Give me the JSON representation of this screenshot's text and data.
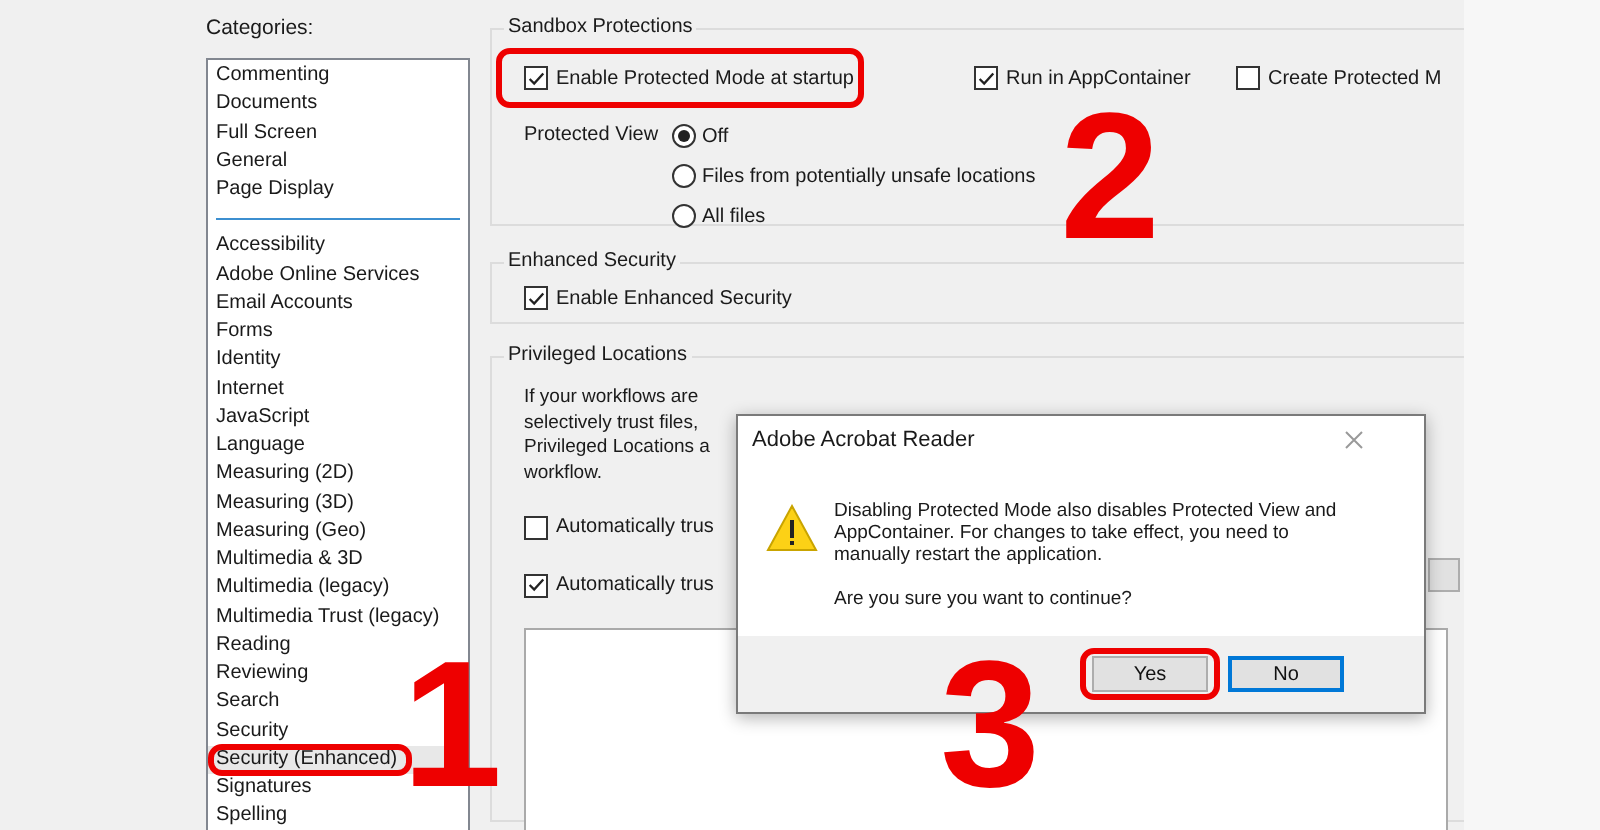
{
  "categories": {
    "label": "Categories:",
    "groups": [
      {
        "items": [
          {
            "label": "Commenting",
            "selected": false,
            "outlined": false
          },
          {
            "label": "Documents",
            "selected": false,
            "outlined": false
          },
          {
            "label": "Full Screen",
            "selected": false,
            "outlined": false
          },
          {
            "label": "General",
            "selected": false,
            "outlined": false
          },
          {
            "label": "Page Display",
            "selected": false,
            "outlined": false
          }
        ]
      },
      {
        "items": [
          {
            "label": "Accessibility",
            "selected": false,
            "outlined": false
          },
          {
            "label": "Adobe Online Services",
            "selected": false,
            "outlined": false
          },
          {
            "label": "Email Accounts",
            "selected": false,
            "outlined": false
          },
          {
            "label": "Forms",
            "selected": false,
            "outlined": false
          },
          {
            "label": "Identity",
            "selected": false,
            "outlined": false
          },
          {
            "label": "Internet",
            "selected": false,
            "outlined": false
          },
          {
            "label": "JavaScript",
            "selected": false,
            "outlined": false
          },
          {
            "label": "Language",
            "selected": false,
            "outlined": false
          },
          {
            "label": "Measuring (2D)",
            "selected": false,
            "outlined": false
          },
          {
            "label": "Measuring (3D)",
            "selected": false,
            "outlined": false
          },
          {
            "label": "Measuring (Geo)",
            "selected": false,
            "outlined": false
          },
          {
            "label": "Multimedia & 3D",
            "selected": false,
            "outlined": false
          },
          {
            "label": "Multimedia (legacy)",
            "selected": false,
            "outlined": false
          },
          {
            "label": "Multimedia Trust (legacy)",
            "selected": false,
            "outlined": false
          },
          {
            "label": "Reading",
            "selected": false,
            "outlined": false
          },
          {
            "label": "Reviewing",
            "selected": false,
            "outlined": false
          },
          {
            "label": "Search",
            "selected": false,
            "outlined": false
          },
          {
            "label": "Security",
            "selected": false,
            "outlined": false
          },
          {
            "label": "Security (Enhanced)",
            "selected": true,
            "outlined": true
          },
          {
            "label": "Signatures",
            "selected": false,
            "outlined": false
          },
          {
            "label": "Spelling",
            "selected": false,
            "outlined": false
          }
        ]
      }
    ]
  },
  "sandbox": {
    "title": "Sandbox Protections",
    "checkboxes": [
      {
        "label": "Enable Protected Mode at startup",
        "checked": true,
        "outlined": true
      },
      {
        "label": "Run in AppContainer",
        "checked": true,
        "outlined": false
      },
      {
        "label": "Create Protected M",
        "checked": false,
        "outlined": false
      }
    ],
    "protected_view": {
      "label": "Protected View",
      "options": [
        {
          "label": "Off",
          "selected": true
        },
        {
          "label": "Files from potentially unsafe locations",
          "selected": false
        },
        {
          "label": "All files",
          "selected": false
        }
      ]
    }
  },
  "enhanced": {
    "title": "Enhanced Security",
    "checkbox": {
      "label": "Enable Enhanced Security",
      "checked": true
    }
  },
  "privileged": {
    "title": "Privileged Locations",
    "text": "If your workflows are\nselectively trust files,\nPrivileged Locations a\nworkflow.",
    "checkboxes": [
      {
        "label": "Automatically trus",
        "checked": false
      },
      {
        "label": "Automatically trus",
        "checked": true
      }
    ]
  },
  "dialog": {
    "title": "Adobe Acrobat Reader",
    "message": "Disabling Protected Mode also disables Protected View and AppContainer. For changes to take effect, you need to manually restart the application.",
    "question": "Are you sure you want to continue?",
    "buttons": [
      {
        "label": "Yes",
        "default": false,
        "outlined": true
      },
      {
        "label": "No",
        "default": true,
        "outlined": false
      }
    ]
  },
  "annotations": [
    {
      "number": "1"
    },
    {
      "number": "2"
    },
    {
      "number": "3"
    }
  ]
}
